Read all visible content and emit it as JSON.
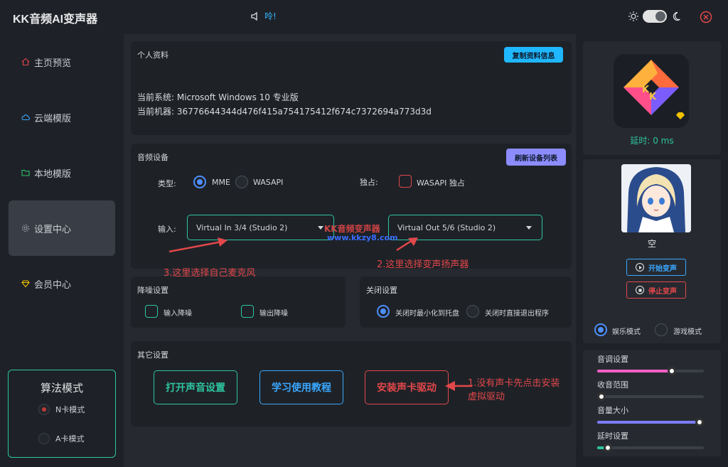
{
  "app": {
    "title": "KK音频AI变声器",
    "notice": "呤!"
  },
  "colors": {
    "accent_green": "#2ec4a0",
    "accent_blue": "#4f8fff",
    "danger_red": "#e2474a",
    "pink": "#ff5ec6",
    "purple": "#7d7dff"
  },
  "sidebar": {
    "items": [
      {
        "label": "主页预览",
        "icon": "home-icon"
      },
      {
        "label": "云端模版",
        "icon": "cloud-icon"
      },
      {
        "label": "本地模版",
        "icon": "folder-icon"
      },
      {
        "label": "设置中心",
        "icon": "gear-icon",
        "active": true
      },
      {
        "label": "会员中心",
        "icon": "diamond-icon"
      }
    ],
    "algo": {
      "title": "算法模式",
      "options": [
        "N卡模式",
        "A卡模式"
      ],
      "selected": "N卡模式"
    }
  },
  "profile": {
    "title": "个人资料",
    "copy_button": "复制资料信息",
    "system_label": "当前系统: ",
    "system_value": "Microsoft Windows 10 专业版",
    "machine_label": "当前机器: ",
    "machine_value": "36776644344d476f415a754175412f674c7372694a773d3d"
  },
  "audio": {
    "title": "音频设备",
    "refresh_button": "刷新设备列表",
    "type_label": "类型:",
    "type_options": [
      "MME",
      "WASAPI"
    ],
    "type_selected": "MME",
    "exclusive_label": "独占:",
    "exclusive_option": "WASAPI 独占",
    "input_label": "输入:",
    "input_value": "Virtual In 3/4 (Studio 2)",
    "output_value": "Virtual Out 5/6 (Studio 2)",
    "watermark_1": "KK音频变声器",
    "watermark_2": "www.kkzy8.com",
    "annotation_input": "3.这里选择自己麦克风",
    "annotation_output": "2.这里选择变声扬声器"
  },
  "noise": {
    "title": "降噪设置",
    "input_option": "输入降噪",
    "output_option": "输出降噪"
  },
  "closing": {
    "title": "关闭设置",
    "options": [
      "关闭时最小化到托盘",
      "关闭时直接退出程序"
    ],
    "selected": "关闭时最小化到托盘"
  },
  "other": {
    "title": "其它设置",
    "buttons": [
      "打开声音设置",
      "学习使用教程",
      "安装声卡驱动"
    ],
    "annotation_line1": "1.没有声卡先点击安装",
    "annotation_line2": "虚拟驱动"
  },
  "right_panel": {
    "latency": "延时: 0 ms",
    "character_name": "空",
    "start_button": "开始变声",
    "stop_button": "停止变声",
    "modes": [
      "娱乐模式",
      "游戏模式"
    ],
    "mode_selected": "娱乐模式",
    "sliders": [
      {
        "label": "音调设置",
        "value": 0.7,
        "color": "#ff5ec6"
      },
      {
        "label": "收音范围",
        "value": 0.04,
        "color": "#3aa7ff"
      },
      {
        "label": "音量大小",
        "value": 0.96,
        "color": "#7d7dff"
      },
      {
        "label": "延时设置",
        "value": 0.1,
        "color": "#2ec4a0"
      }
    ]
  }
}
